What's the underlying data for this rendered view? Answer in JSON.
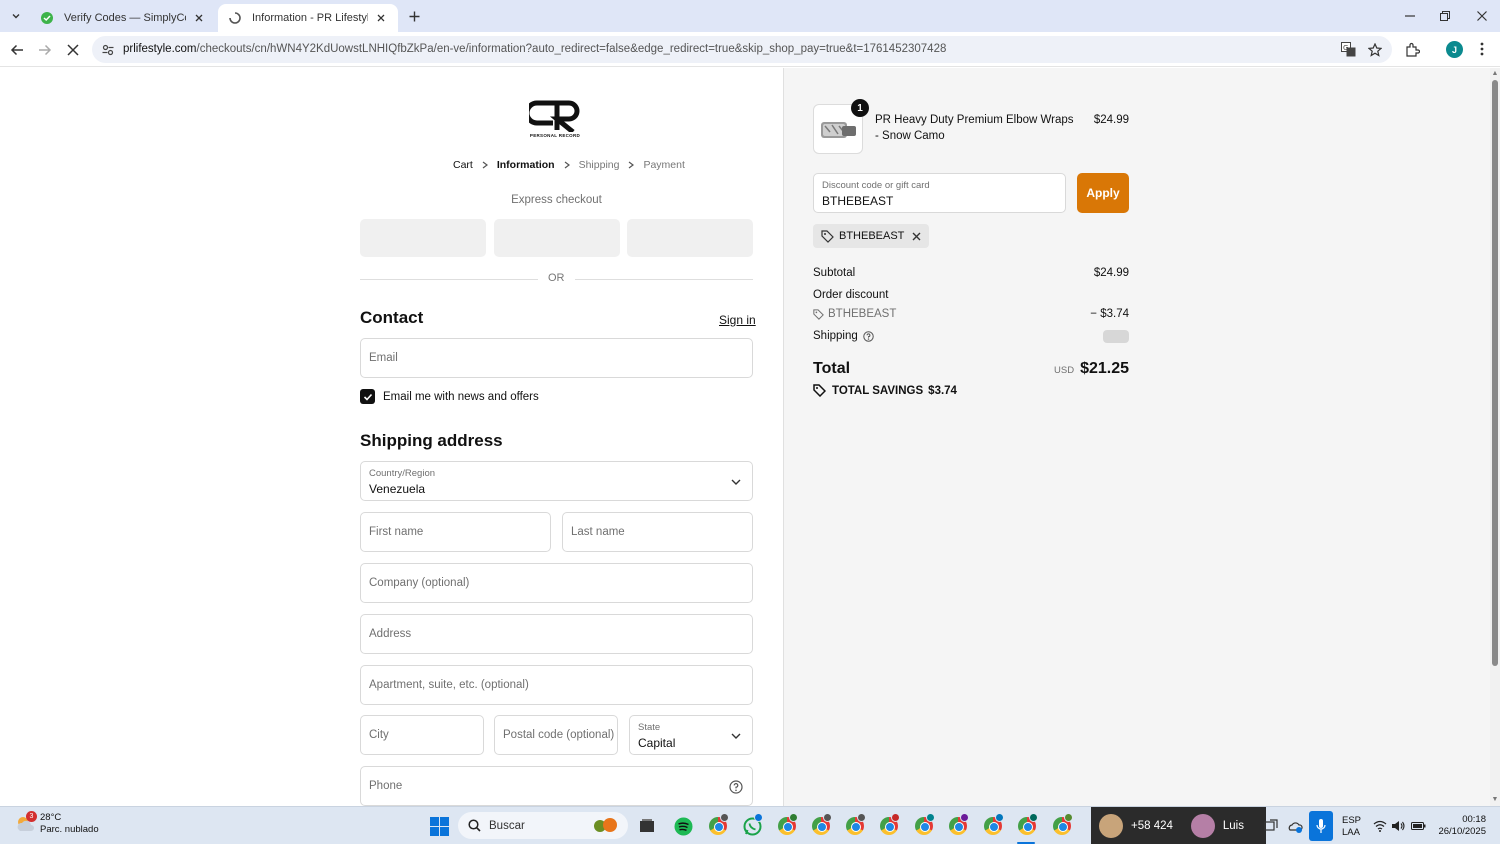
{
  "browser": {
    "tabs": [
      {
        "title": "Verify Codes — SimplyCodes",
        "icon": "simplycodes-favicon"
      },
      {
        "title": "Information - PR Lifestyle - Che",
        "icon": "loading-favicon"
      }
    ],
    "url_host": "prlifestyle.com",
    "url_rest": "/checkouts/cn/hWN4Y2KdUowstLNHIQfbZkPa/en-ve/information?auto_redirect=false&edge_redirect=true&skip_shop_pay=true&t=1761452307428",
    "profile_initial": "J"
  },
  "checkout": {
    "logo_subtitle": "PERSONAL RECORD",
    "breadcrumb": [
      "Cart",
      "Information",
      "Shipping",
      "Payment"
    ],
    "express_title": "Express checkout",
    "or_text": "OR",
    "contact_title": "Contact",
    "sign_in": "Sign in",
    "email_placeholder": "Email",
    "newsletter_label": "Email me with news and offers",
    "newsletter_checked": true,
    "shipping_title": "Shipping address",
    "country_label": "Country/Region",
    "country_value": "Venezuela",
    "first_name": "First name",
    "last_name": "Last name",
    "company": "Company (optional)",
    "address": "Address",
    "apartment": "Apartment, suite, etc. (optional)",
    "city": "City",
    "postal": "Postal code (optional)",
    "state_label": "State",
    "state_value": "Capital",
    "phone": "Phone"
  },
  "summary": {
    "product_qty": "1",
    "product_name": "PR Heavy Duty Premium Elbow Wraps - Snow Camo",
    "product_price": "$24.99",
    "discount_label": "Discount code or gift card",
    "discount_value": "BTHEBEAST",
    "apply": "Apply",
    "applied_code": "BTHEBEAST",
    "subtotal_label": "Subtotal",
    "subtotal_value": "$24.99",
    "order_discount_label": "Order discount",
    "discount_code_label": "BTHEBEAST",
    "discount_amount": "− $3.74",
    "shipping_label": "Shipping",
    "total_label": "Total",
    "currency": "USD",
    "total_value": "$21.25",
    "savings_label": "TOTAL SAVINGS",
    "savings_value": "$3.74",
    "accent_color": "#d97706"
  },
  "taskbar": {
    "weather_badge": "3",
    "temperature": "28°C",
    "weather_text": "Parc. nublado",
    "search_placeholder": "Buscar",
    "call_number": "+58 424",
    "call_name": "Luis",
    "lang_line1": "ESP",
    "lang_line2": "LAA",
    "time": "00:18",
    "date": "26/10/2025"
  }
}
